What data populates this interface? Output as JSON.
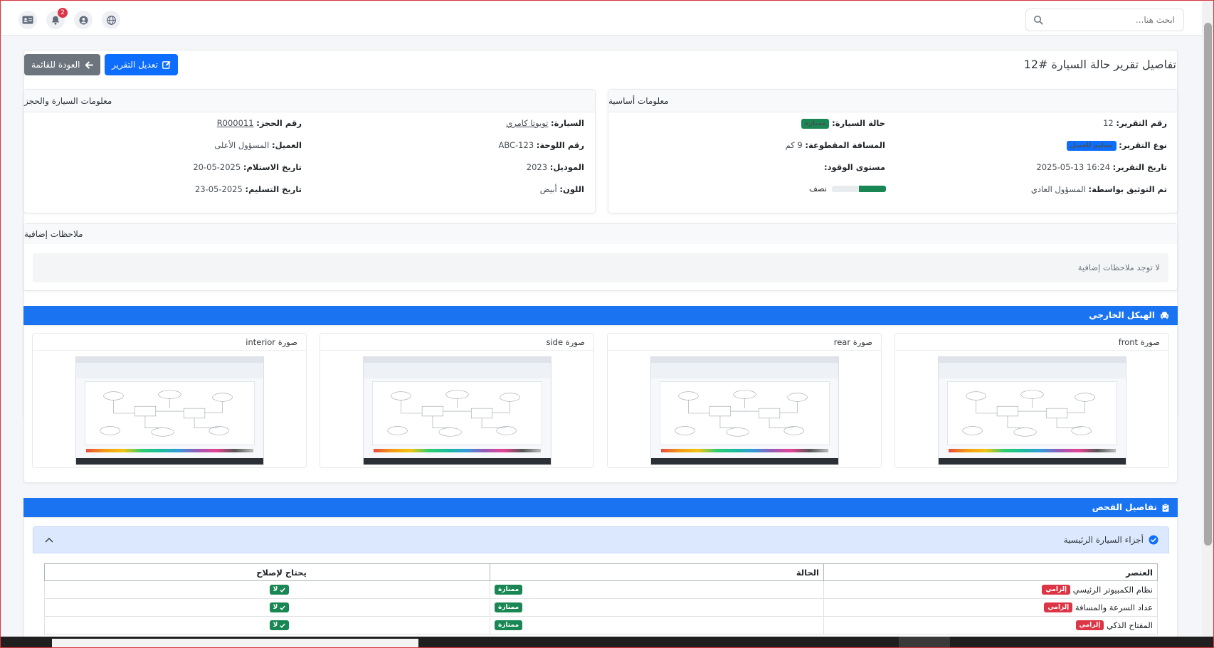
{
  "topbar": {
    "search_placeholder": "ابحث هنا...",
    "notification_count": "2",
    "icons": [
      "search-icon",
      "id-card-icon",
      "bell-icon",
      "user-circle-icon",
      "globe-icon"
    ]
  },
  "header": {
    "title": "تفاصيل تقرير حالة السيارة #12",
    "edit_button": "تعديل التقرير",
    "back_button": "العودة للقائمة"
  },
  "basic_info": {
    "heading": "معلومات أساسية",
    "report_number_label": "رقم التقرير:",
    "report_number": "12",
    "report_type_label": "نوع التقرير:",
    "report_type": "تسليم للعميل",
    "report_date_label": "تاريخ التقرير:",
    "report_date": "2025-05-13 16:24",
    "documented_by_label": "تم التوثيق بواسطة:",
    "documented_by": "المسؤول العادي",
    "car_condition_label": "حالة السيارة:",
    "car_condition": "ممتازة",
    "distance_label": "المسافة المقطوعة:",
    "distance": "9 كم",
    "fuel_label": "مستوى الوقود:",
    "fuel_text": "نصف",
    "fuel_fraction": 0.5
  },
  "car_booking": {
    "heading": "معلومات السيارة والحجز",
    "car_label": "السيارة:",
    "car": "تويوتا كامري",
    "plate_label": "رقم اللوحة:",
    "plate": "ABC-123",
    "model_label": "الموديل:",
    "model": "2023",
    "color_label": "اللون:",
    "color": "أبيض",
    "booking_label": "رقم الحجز:",
    "booking": "R000011",
    "client_label": "العميل:",
    "client": "المسؤول الأعلى",
    "receipt_date_label": "تاريخ الاستلام:",
    "receipt_date": "2025-05-20",
    "delivery_date_label": "تاريخ التسليم:",
    "delivery_date": "2025-05-23"
  },
  "notes": {
    "heading": "ملاحظات إضافية",
    "empty_text": "لا توجد ملاحظات إضافية"
  },
  "exterior": {
    "heading": "الهيكل الخارجي",
    "photos": [
      {
        "title": "صورة front"
      },
      {
        "title": "صورة rear"
      },
      {
        "title": "صورة side"
      },
      {
        "title": "صورة interior"
      }
    ]
  },
  "inspection": {
    "heading": "تفاصيل الفحص",
    "section_title": "أجزاء السيارة الرئيسية",
    "columns": [
      "العنصر",
      "الحالة",
      "يحتاج لإصلاح"
    ],
    "required_badge": "إلزامي",
    "rows": [
      {
        "item": "نظام الكمبيوتر الرئيسي",
        "status": "ممتازة",
        "needs_repair": "لا"
      },
      {
        "item": "عداد السرعة والمسافة",
        "status": "ممتازة",
        "needs_repair": "لا"
      },
      {
        "item": "المفتاح الذكي",
        "status": "ممتازة",
        "needs_repair": "لا"
      }
    ]
  },
  "colors": {
    "primary": "#0d6efd",
    "secondary": "#6c757d",
    "success": "#198754",
    "danger": "#dc3545",
    "section_bar": "#1a73f0"
  }
}
